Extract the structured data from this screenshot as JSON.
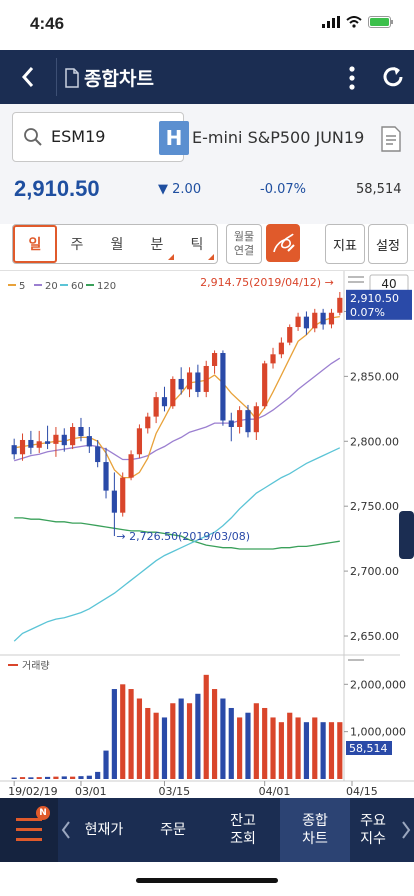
{
  "status": {
    "time": "4:46"
  },
  "header": {
    "title": "종합차트",
    "icons": [
      "back-icon",
      "doc-icon",
      "more-icon",
      "refresh-icon"
    ]
  },
  "search": {
    "value": "ESM19",
    "badge": "H",
    "product_name": "E-mini S&P500 JUN19"
  },
  "quote": {
    "price": "2,910.50",
    "change": "2.00",
    "change_dir": "down",
    "pct": "-0.07%",
    "volume": "58,514"
  },
  "periods": [
    {
      "label": "일",
      "active": true,
      "has_menu": false
    },
    {
      "label": "주",
      "active": false,
      "has_menu": false
    },
    {
      "label": "월",
      "active": false,
      "has_menu": false
    },
    {
      "label": "분",
      "active": false,
      "has_menu": true
    },
    {
      "label": "틱",
      "active": false,
      "has_menu": true
    }
  ],
  "link_button": "월물\n연결",
  "indicator_button": "지표",
  "settings_button": "설정",
  "chart_colors": {
    "up": "#d9452b",
    "down": "#2a4aa8",
    "ma5": "#e8a23a",
    "ma20": "#9b7fd0",
    "ma60": "#5bc4d6",
    "ma120": "#3aa05a"
  },
  "chart_data": {
    "type": "candlestick",
    "ma_legend": [
      "5",
      "20",
      "60",
      "120"
    ],
    "period_count": "40",
    "y_ticks": [
      "2,900.00",
      "2,850.00",
      "2,800.00",
      "2,750.00",
      "2,700.00",
      "2,650.00"
    ],
    "y_tick_values": [
      2900,
      2850,
      2800,
      2750,
      2700,
      2650
    ],
    "ylim": [
      2640,
      2925
    ],
    "current_price_label": "2,910.50",
    "current_pct_label": "0.07%",
    "high_annotation": "2,914.75(2019/04/12)",
    "low_annotation": "2,726.50(2019/03/08)",
    "candles": [
      [
        2797,
        2802,
        2786,
        2790
      ],
      [
        2790,
        2806,
        2785,
        2801
      ],
      [
        2801,
        2808,
        2790,
        2795
      ],
      [
        2795,
        2808,
        2791,
        2800
      ],
      [
        2800,
        2812,
        2794,
        2798
      ],
      [
        2798,
        2811,
        2788,
        2805
      ],
      [
        2805,
        2810,
        2792,
        2797
      ],
      [
        2797,
        2814,
        2794,
        2811
      ],
      [
        2811,
        2818,
        2800,
        2804
      ],
      [
        2804,
        2811,
        2791,
        2796
      ],
      [
        2796,
        2801,
        2780,
        2784
      ],
      [
        2784,
        2795,
        2756,
        2762
      ],
      [
        2762,
        2776,
        2727,
        2745
      ],
      [
        2745,
        2776,
        2742,
        2772
      ],
      [
        2772,
        2793,
        2770,
        2790
      ],
      [
        2790,
        2813,
        2787,
        2810
      ],
      [
        2810,
        2822,
        2806,
        2819
      ],
      [
        2819,
        2838,
        2814,
        2834
      ],
      [
        2834,
        2842,
        2823,
        2827
      ],
      [
        2827,
        2850,
        2825,
        2848
      ],
      [
        2848,
        2857,
        2836,
        2840
      ],
      [
        2840,
        2857,
        2834,
        2853
      ],
      [
        2853,
        2859,
        2834,
        2838
      ],
      [
        2838,
        2862,
        2834,
        2858
      ],
      [
        2858,
        2870,
        2852,
        2868
      ],
      [
        2868,
        2870,
        2812,
        2816
      ],
      [
        2816,
        2822,
        2800,
        2811
      ],
      [
        2811,
        2827,
        2806,
        2824
      ],
      [
        2824,
        2828,
        2803,
        2807
      ],
      [
        2807,
        2830,
        2801,
        2827
      ],
      [
        2827,
        2862,
        2825,
        2860
      ],
      [
        2860,
        2872,
        2856,
        2867
      ],
      [
        2867,
        2880,
        2864,
        2876
      ],
      [
        2876,
        2890,
        2874,
        2888
      ],
      [
        2888,
        2899,
        2885,
        2896
      ],
      [
        2896,
        2900,
        2882,
        2887
      ],
      [
        2887,
        2902,
        2884,
        2899
      ],
      [
        2899,
        2902,
        2886,
        2890
      ],
      [
        2890,
        2902,
        2887,
        2899
      ],
      [
        2899,
        2915,
        2897,
        2910.5
      ]
    ],
    "ma5": [
      2795,
      2796,
      2797,
      2798,
      2799,
      2800,
      2800,
      2802,
      2803,
      2803,
      2800,
      2791,
      2778,
      2772,
      2772,
      2776,
      2787,
      2806,
      2818,
      2830,
      2837,
      2845,
      2846,
      2847,
      2851,
      2845,
      2837,
      2831,
      2825,
      2817,
      2826,
      2838,
      2851,
      2864,
      2877,
      2882,
      2889,
      2893,
      2895,
      2896
    ],
    "ma20": [
      2785,
      2787,
      2789,
      2790,
      2792,
      2793,
      2794,
      2795,
      2796,
      2797,
      2796,
      2794,
      2790,
      2786,
      2786,
      2787,
      2789,
      2793,
      2796,
      2800,
      2803,
      2807,
      2809,
      2811,
      2814,
      2814,
      2814,
      2816,
      2817,
      2817,
      2820,
      2824,
      2829,
      2834,
      2840,
      2845,
      2850,
      2855,
      2860,
      2864
    ],
    "ma60": [
      2646,
      2652,
      2655,
      2658,
      2661,
      2663,
      2664,
      2666,
      2668,
      2671,
      2675,
      2679,
      2683,
      2688,
      2693,
      2698,
      2703,
      2708,
      2712,
      2715,
      2718,
      2721,
      2724,
      2727,
      2730,
      2735,
      2741,
      2748,
      2754,
      2760,
      2764,
      2768,
      2772,
      2775,
      2779,
      2783,
      2786,
      2789,
      2792,
      2795
    ],
    "ma120": [
      2741,
      2741,
      2740,
      2740,
      2739,
      2738,
      2738,
      2737,
      2737,
      2736,
      2735,
      2734,
      2733,
      2732,
      2731,
      2731,
      2730,
      2730,
      2729,
      2728,
      2727,
      2724,
      2722,
      2720,
      2719,
      2718,
      2718,
      2717,
      2717,
      2717,
      2717,
      2717,
      2718,
      2718,
      2719,
      2719,
      2720,
      2721,
      2722,
      2723
    ],
    "volume_label": "거래량",
    "volume_ticks": [
      "2,000,000",
      "1,000,000"
    ],
    "volume_tick_values": [
      2000000,
      1000000
    ],
    "volume_max": 2450000,
    "volume_current_label": "58,514",
    "volumes": [
      30000,
      40000,
      35000,
      40000,
      45000,
      50000,
      55000,
      50000,
      60000,
      70000,
      150000,
      600000,
      1900000,
      2000000,
      1900000,
      1700000,
      1500000,
      1400000,
      1300000,
      1600000,
      1700000,
      1600000,
      1800000,
      2200000,
      1900000,
      1700000,
      1500000,
      1300000,
      1400000,
      1600000,
      1500000,
      1300000,
      1200000,
      1400000,
      1300000,
      1200000,
      1300000,
      1200000,
      1200000,
      1200000
    ],
    "x_ticks": [
      {
        "label": "19/02/19",
        "index": 0
      },
      {
        "label": "03/01",
        "index": 8
      },
      {
        "label": "03/15",
        "index": 18
      },
      {
        "label": "04/01",
        "index": 30
      },
      {
        "label": "04/15",
        "index": 40
      }
    ]
  },
  "nav": [
    {
      "label": "현재가",
      "active": false
    },
    {
      "label": "주문",
      "active": false
    },
    {
      "label": "잔고\n조회",
      "active": false
    },
    {
      "label": "종합\n차트",
      "active": true
    },
    {
      "label": "주요\n지수",
      "active": false
    }
  ],
  "nav_badge": "N"
}
